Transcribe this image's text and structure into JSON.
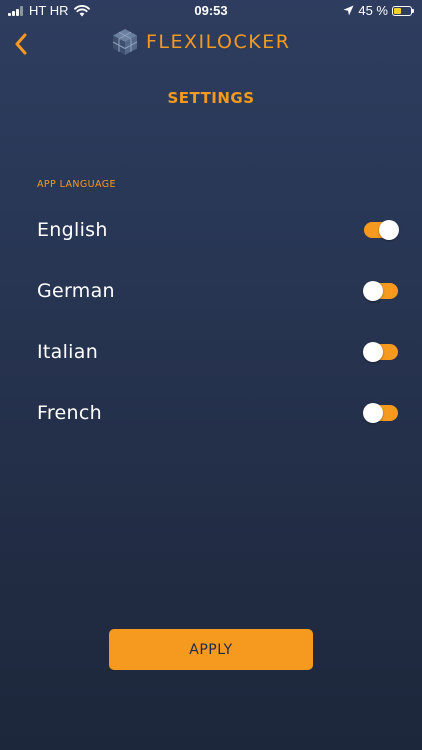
{
  "status_bar": {
    "carrier": "HT HR",
    "time": "09:53",
    "battery_percent": "45 %",
    "battery_level": 0.45,
    "icons": [
      "signal-icon",
      "wifi-icon",
      "location-icon",
      "battery-icon"
    ]
  },
  "header": {
    "back_icon": "chevron-left-icon",
    "brand_name": "FLEXILOCKER",
    "logo_icon": "cube-logo-icon"
  },
  "page": {
    "title": "SETTINGS"
  },
  "language_section": {
    "label": "APP LANGUAGE",
    "items": [
      {
        "label": "English",
        "enabled": true
      },
      {
        "label": "German",
        "enabled": false
      },
      {
        "label": "Italian",
        "enabled": false
      },
      {
        "label": "French",
        "enabled": false
      }
    ]
  },
  "actions": {
    "apply_label": "APPLY"
  },
  "colors": {
    "accent": "#f59a1f",
    "background_top": "#2e3d5f",
    "background_bottom": "#1d273b",
    "text": "#ffffff",
    "button_text": "#1f2a44"
  }
}
